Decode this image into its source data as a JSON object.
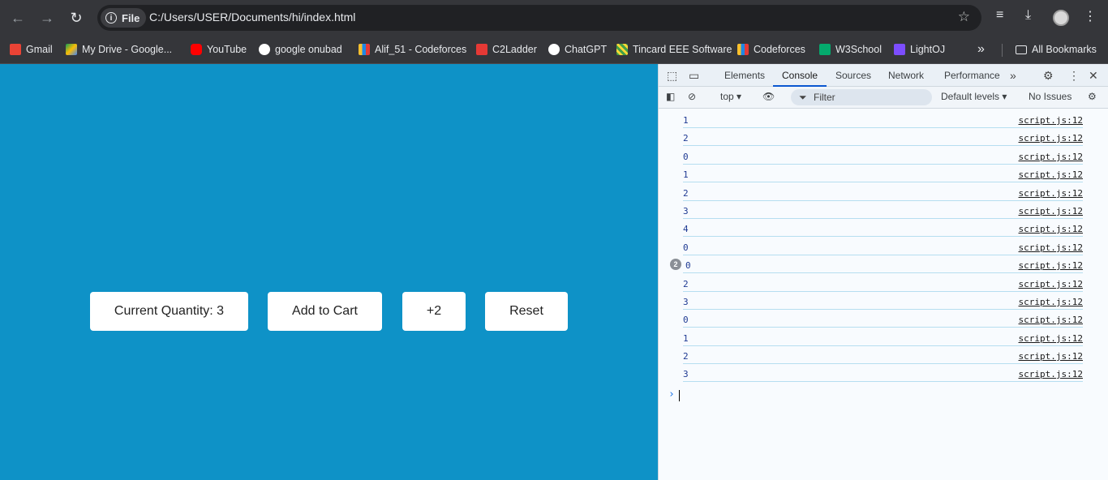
{
  "browser": {
    "site_chip": "File",
    "url": "C:/Users/USER/Documents/hi/index.html"
  },
  "bookmarks": {
    "items": [
      {
        "label": "Gmail",
        "color": "#ea4335"
      },
      {
        "label": "My Drive - Google...",
        "color": "#fbbc04"
      },
      {
        "label": "YouTube",
        "color": "#ff0000"
      },
      {
        "label": "google onubad",
        "color": "#4285f4"
      },
      {
        "label": "Alif_51 - Codeforces",
        "color": "#1e88e5"
      },
      {
        "label": "C2Ladder",
        "color": "#e53935"
      },
      {
        "label": "ChatGPT",
        "color": "#ffffff"
      },
      {
        "label": "Tincard EEE Software",
        "color": "#43a047"
      },
      {
        "label": "Codeforces",
        "color": "#1e88e5"
      },
      {
        "label": "W3School",
        "color": "#04aa6d"
      },
      {
        "label": "LightOJ",
        "color": "#7c4dff"
      }
    ],
    "overflow": "»",
    "all_bookmarks": "All Bookmarks"
  },
  "app": {
    "quantity_label": "Current Quantity: 3",
    "add_to_cart_label": "Add to Cart",
    "plus_two_label": "+2",
    "reset_label": "Reset",
    "background_color": "#0e92c7"
  },
  "devtools": {
    "tabs": [
      "Elements",
      "Console",
      "Sources",
      "Network",
      "Performance"
    ],
    "active_tab": "Console",
    "context": "top",
    "filter_placeholder": "Filter",
    "levels": "Default levels",
    "issues": "No Issues",
    "logs": [
      {
        "value": "1",
        "source": "script.js:12"
      },
      {
        "value": "2",
        "source": "script.js:12"
      },
      {
        "value": "0",
        "source": "script.js:12"
      },
      {
        "value": "1",
        "source": "script.js:12"
      },
      {
        "value": "2",
        "source": "script.js:12"
      },
      {
        "value": "3",
        "source": "script.js:12"
      },
      {
        "value": "4",
        "source": "script.js:12"
      },
      {
        "value": "0",
        "source": "script.js:12"
      },
      {
        "value": "0",
        "source": "script.js:12",
        "count": "2"
      },
      {
        "value": "2",
        "source": "script.js:12"
      },
      {
        "value": "3",
        "source": "script.js:12"
      },
      {
        "value": "0",
        "source": "script.js:12"
      },
      {
        "value": "1",
        "source": "script.js:12"
      },
      {
        "value": "2",
        "source": "script.js:12"
      },
      {
        "value": "3",
        "source": "script.js:12"
      }
    ],
    "prompt": "›"
  }
}
